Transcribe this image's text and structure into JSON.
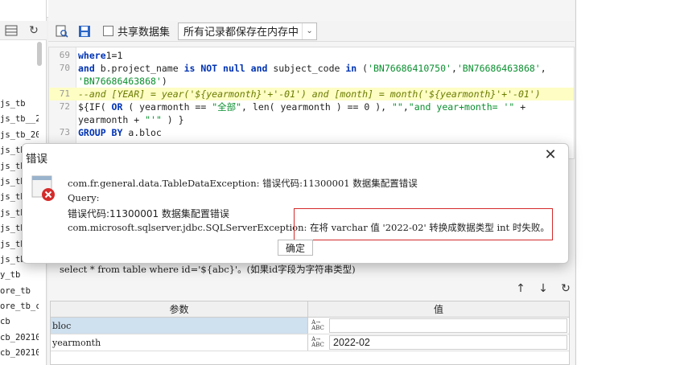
{
  "left_panel": {
    "tree_items": [
      "js_tb",
      "js_tb__2",
      "js_tb_20",
      "js_tb",
      "js_tb",
      "js_tb",
      "js_tb",
      "js_tb",
      "js_tb",
      "js_tb",
      "js_tb",
      "y_tb",
      "ore_tb",
      "ore_tb_c",
      "cb",
      "cb_20210",
      "cb_20210",
      "cb_20211"
    ]
  },
  "toolbar": {
    "share_label": "共享数据集",
    "memory_option": "所有记录都保存在内存中"
  },
  "code": {
    "lines": [
      {
        "n": "69",
        "parts": [
          [
            "kw",
            "where"
          ],
          [
            "",
            "1=1"
          ]
        ]
      },
      {
        "n": "70",
        "parts": [
          [
            "kw",
            "and"
          ],
          [
            "",
            " b.project_name "
          ],
          [
            "kw",
            "is NOT null and"
          ],
          [
            "",
            " subject_code "
          ],
          [
            "kw",
            "in"
          ],
          [
            "",
            " ("
          ],
          [
            "str",
            "'BN76686410750'"
          ],
          [
            "",
            ","
          ],
          [
            "str",
            "'BN76686463868'"
          ],
          [
            "",
            ","
          ]
        ]
      },
      {
        "n": "",
        "parts": [
          [
            "str",
            "'BN76686463868'"
          ],
          [
            "",
            ")"
          ]
        ]
      },
      {
        "n": "71",
        "hl": true,
        "parts": [
          [
            "cmt",
            "--and [YEAR] = year('${yearmonth}'+'-01') and [month] = month('${yearmonth}'+'-01')"
          ]
        ]
      },
      {
        "n": "72",
        "parts": [
          [
            "",
            "${IF( "
          ],
          [
            "kw",
            "OR"
          ],
          [
            "",
            " ( yearmonth == "
          ],
          [
            "str",
            "\"全部\""
          ],
          [
            "",
            ", len( yearmonth ) == 0 ), "
          ],
          [
            "str",
            "\"\""
          ],
          [
            "",
            ","
          ],
          [
            "str",
            "\"and year+month= '\""
          ],
          [
            "",
            " +"
          ]
        ]
      },
      {
        "n": "",
        "parts": [
          [
            "",
            "yearmonth + "
          ],
          [
            "str",
            "\"'\""
          ],
          [
            "",
            " ) }"
          ]
        ]
      },
      {
        "n": "73",
        "parts": [
          [
            "kw",
            "GROUP BY"
          ],
          [
            "",
            " a.bloc"
          ]
        ]
      }
    ]
  },
  "hint_text": "select * from table where id='${abc}'。(如果id字段为字符串类型)",
  "params": {
    "header_name": "参数",
    "header_value": "值",
    "type_glyph": "A→ ABC",
    "rows": [
      {
        "name": "bloc",
        "value": "",
        "selected": true
      },
      {
        "name": "yearmonth",
        "value": "2022-02",
        "selected": false
      }
    ]
  },
  "dialog": {
    "title": "错误",
    "line1": "com.fr.general.data.TableDataException: 错误代码:11300001 数据集配置错误",
    "line2": "Query:",
    "line3": "错误代码:11300001 数据集配置错误",
    "line4a": "com.microsoft.sqlserver.jdbc.SQLServerException:",
    "line4b": " 在将 varchar 值 '2022-02' 转换成数据类型 int 时失败。",
    "ok_label": "确定"
  }
}
